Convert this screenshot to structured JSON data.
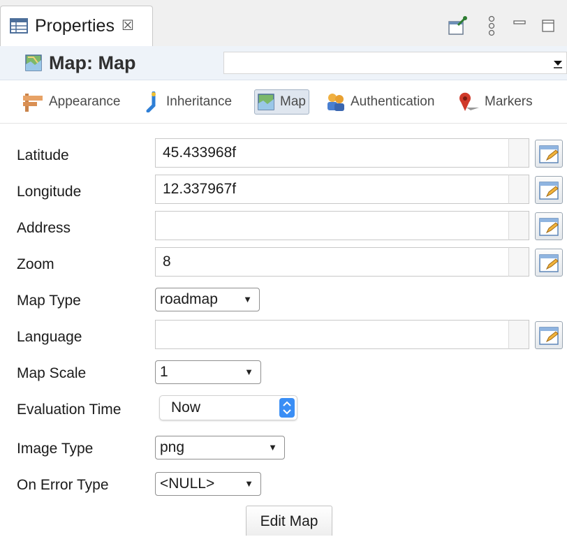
{
  "view_tab": {
    "label": "Properties",
    "close_glyph": "☒",
    "icon": "table-icon"
  },
  "view_toolbar": {
    "icons": [
      "pin-view-icon",
      "view-menu-icon",
      "minimize-icon",
      "maximize-icon"
    ]
  },
  "header": {
    "title": "Map: Map",
    "icon": "map-icon"
  },
  "section_tabs": [
    {
      "label": "Appearance",
      "icon": "signpost-icon"
    },
    {
      "label": "Inheritance",
      "icon": "inheritance-icon"
    },
    {
      "label": "Map",
      "icon": "map-icon",
      "selected": true
    },
    {
      "label": "Authentication",
      "icon": "people-icon"
    },
    {
      "label": "Markers",
      "icon": "marker-pin-icon"
    }
  ],
  "form": {
    "latitude": {
      "label": "Latitude",
      "value": "45.433968f"
    },
    "longitude": {
      "label": "Longitude",
      "value": "12.337967f"
    },
    "address": {
      "label": "Address",
      "value": ""
    },
    "zoom": {
      "label": "Zoom",
      "value": "8"
    },
    "map_type": {
      "label": "Map Type",
      "value": "roadmap"
    },
    "language": {
      "label": "Language",
      "value": ""
    },
    "map_scale": {
      "label": "Map Scale",
      "value": "1"
    },
    "evaluation_time": {
      "label": "Evaluation Time",
      "value": "Now"
    },
    "image_type": {
      "label": "Image Type",
      "value": "png"
    },
    "on_error_type": {
      "label": "On Error Type",
      "value": "<NULL>"
    }
  },
  "buttons": {
    "edit_map": "Edit Map"
  },
  "colors": {
    "accent_blue": "#3a8ef5",
    "selected_tab_bg": "#dfe6ef",
    "header_bg": "#eef3f9"
  }
}
